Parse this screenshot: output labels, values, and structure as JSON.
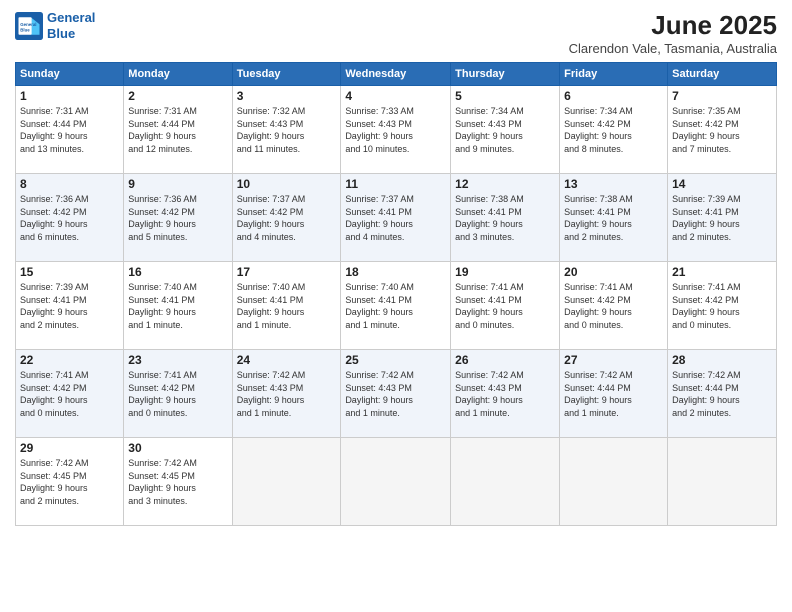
{
  "header": {
    "logo_line1": "General",
    "logo_line2": "Blue",
    "title": "June 2025",
    "subtitle": "Clarendon Vale, Tasmania, Australia"
  },
  "days_of_week": [
    "Sunday",
    "Monday",
    "Tuesday",
    "Wednesday",
    "Thursday",
    "Friday",
    "Saturday"
  ],
  "weeks": [
    [
      {
        "day": "1",
        "info": "Sunrise: 7:31 AM\nSunset: 4:44 PM\nDaylight: 9 hours\nand 13 minutes."
      },
      {
        "day": "2",
        "info": "Sunrise: 7:31 AM\nSunset: 4:44 PM\nDaylight: 9 hours\nand 12 minutes."
      },
      {
        "day": "3",
        "info": "Sunrise: 7:32 AM\nSunset: 4:43 PM\nDaylight: 9 hours\nand 11 minutes."
      },
      {
        "day": "4",
        "info": "Sunrise: 7:33 AM\nSunset: 4:43 PM\nDaylight: 9 hours\nand 10 minutes."
      },
      {
        "day": "5",
        "info": "Sunrise: 7:34 AM\nSunset: 4:43 PM\nDaylight: 9 hours\nand 9 minutes."
      },
      {
        "day": "6",
        "info": "Sunrise: 7:34 AM\nSunset: 4:42 PM\nDaylight: 9 hours\nand 8 minutes."
      },
      {
        "day": "7",
        "info": "Sunrise: 7:35 AM\nSunset: 4:42 PM\nDaylight: 9 hours\nand 7 minutes."
      }
    ],
    [
      {
        "day": "8",
        "info": "Sunrise: 7:36 AM\nSunset: 4:42 PM\nDaylight: 9 hours\nand 6 minutes."
      },
      {
        "day": "9",
        "info": "Sunrise: 7:36 AM\nSunset: 4:42 PM\nDaylight: 9 hours\nand 5 minutes."
      },
      {
        "day": "10",
        "info": "Sunrise: 7:37 AM\nSunset: 4:42 PM\nDaylight: 9 hours\nand 4 minutes."
      },
      {
        "day": "11",
        "info": "Sunrise: 7:37 AM\nSunset: 4:41 PM\nDaylight: 9 hours\nand 4 minutes."
      },
      {
        "day": "12",
        "info": "Sunrise: 7:38 AM\nSunset: 4:41 PM\nDaylight: 9 hours\nand 3 minutes."
      },
      {
        "day": "13",
        "info": "Sunrise: 7:38 AM\nSunset: 4:41 PM\nDaylight: 9 hours\nand 2 minutes."
      },
      {
        "day": "14",
        "info": "Sunrise: 7:39 AM\nSunset: 4:41 PM\nDaylight: 9 hours\nand 2 minutes."
      }
    ],
    [
      {
        "day": "15",
        "info": "Sunrise: 7:39 AM\nSunset: 4:41 PM\nDaylight: 9 hours\nand 2 minutes."
      },
      {
        "day": "16",
        "info": "Sunrise: 7:40 AM\nSunset: 4:41 PM\nDaylight: 9 hours\nand 1 minute."
      },
      {
        "day": "17",
        "info": "Sunrise: 7:40 AM\nSunset: 4:41 PM\nDaylight: 9 hours\nand 1 minute."
      },
      {
        "day": "18",
        "info": "Sunrise: 7:40 AM\nSunset: 4:41 PM\nDaylight: 9 hours\nand 1 minute."
      },
      {
        "day": "19",
        "info": "Sunrise: 7:41 AM\nSunset: 4:41 PM\nDaylight: 9 hours\nand 0 minutes."
      },
      {
        "day": "20",
        "info": "Sunrise: 7:41 AM\nSunset: 4:42 PM\nDaylight: 9 hours\nand 0 minutes."
      },
      {
        "day": "21",
        "info": "Sunrise: 7:41 AM\nSunset: 4:42 PM\nDaylight: 9 hours\nand 0 minutes."
      }
    ],
    [
      {
        "day": "22",
        "info": "Sunrise: 7:41 AM\nSunset: 4:42 PM\nDaylight: 9 hours\nand 0 minutes."
      },
      {
        "day": "23",
        "info": "Sunrise: 7:41 AM\nSunset: 4:42 PM\nDaylight: 9 hours\nand 0 minutes."
      },
      {
        "day": "24",
        "info": "Sunrise: 7:42 AM\nSunset: 4:43 PM\nDaylight: 9 hours\nand 1 minute."
      },
      {
        "day": "25",
        "info": "Sunrise: 7:42 AM\nSunset: 4:43 PM\nDaylight: 9 hours\nand 1 minute."
      },
      {
        "day": "26",
        "info": "Sunrise: 7:42 AM\nSunset: 4:43 PM\nDaylight: 9 hours\nand 1 minute."
      },
      {
        "day": "27",
        "info": "Sunrise: 7:42 AM\nSunset: 4:44 PM\nDaylight: 9 hours\nand 1 minute."
      },
      {
        "day": "28",
        "info": "Sunrise: 7:42 AM\nSunset: 4:44 PM\nDaylight: 9 hours\nand 2 minutes."
      }
    ],
    [
      {
        "day": "29",
        "info": "Sunrise: 7:42 AM\nSunset: 4:45 PM\nDaylight: 9 hours\nand 2 minutes."
      },
      {
        "day": "30",
        "info": "Sunrise: 7:42 AM\nSunset: 4:45 PM\nDaylight: 9 hours\nand 3 minutes."
      },
      {
        "day": "",
        "info": ""
      },
      {
        "day": "",
        "info": ""
      },
      {
        "day": "",
        "info": ""
      },
      {
        "day": "",
        "info": ""
      },
      {
        "day": "",
        "info": ""
      }
    ]
  ]
}
